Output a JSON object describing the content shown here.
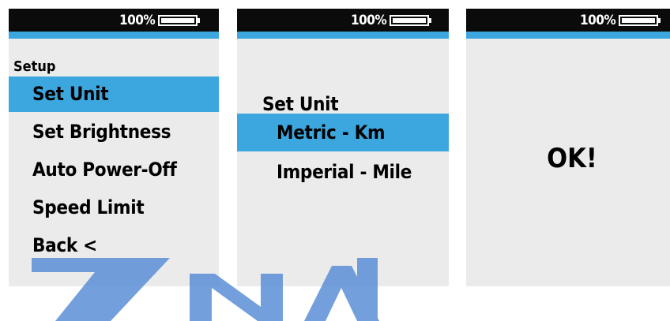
{
  "status_bar": {
    "battery_percent": "100%",
    "battery_level": 1.0
  },
  "screen1": {
    "heading": "Setup",
    "items": [
      "Set Unit",
      "Set Brightness",
      "Auto Power-Off",
      "Speed Limit",
      "Back <"
    ],
    "selected_index": 0
  },
  "screen2": {
    "heading": "Set Unit",
    "options": [
      "Metric - Km",
      "Imperial - Mile"
    ],
    "selected_index": 0
  },
  "screen3": {
    "message": "OK!"
  },
  "colors": {
    "accent": "#3ba7de",
    "status_bar": "#0b0b0b",
    "screen_bg": "#ebebeb"
  }
}
